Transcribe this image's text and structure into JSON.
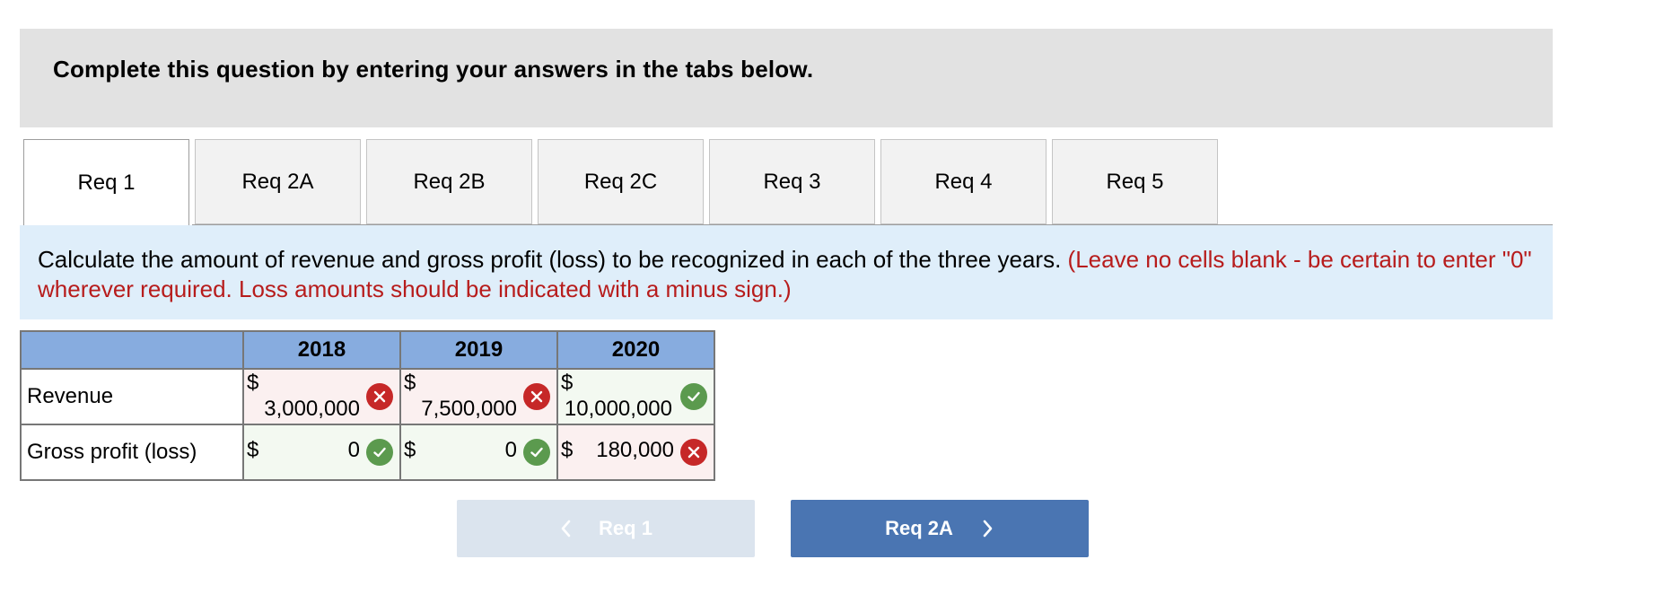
{
  "banner": {
    "title": "Complete this question by entering your answers in the tabs below."
  },
  "tabs": [
    {
      "label": "Req 1",
      "active": true
    },
    {
      "label": "Req 2A",
      "active": false
    },
    {
      "label": "Req 2B",
      "active": false
    },
    {
      "label": "Req 2C",
      "active": false
    },
    {
      "label": "Req 3",
      "active": false
    },
    {
      "label": "Req 4",
      "active": false
    },
    {
      "label": "Req 5",
      "active": false
    }
  ],
  "instructions": {
    "text": "Calculate the amount of revenue and gross profit (loss) to be recognized in each of the three years. ",
    "note": "(Leave no cells blank - be certain to enter \"0\" wherever required. Loss amounts should be indicated with a minus sign.)"
  },
  "table": {
    "corner": "",
    "columns": [
      "2018",
      "2019",
      "2020"
    ],
    "rows": [
      {
        "label": "Revenue",
        "cells": [
          {
            "symbol": "$",
            "value": "3,000,000",
            "status": "incorrect"
          },
          {
            "symbol": "$",
            "value": "7,500,000",
            "status": "incorrect"
          },
          {
            "symbol": "$",
            "value": "10,000,000",
            "status": "correct"
          }
        ]
      },
      {
        "label": "Gross profit (loss)",
        "cells": [
          {
            "symbol": "$",
            "value": "0",
            "status": "correct"
          },
          {
            "symbol": "$",
            "value": "0",
            "status": "correct"
          },
          {
            "symbol": "$",
            "value": "180,000",
            "status": "incorrect"
          }
        ]
      }
    ]
  },
  "nav": {
    "prev_label": "Req 1",
    "next_label": "Req 2A"
  },
  "colors": {
    "incorrect": "#c62828",
    "correct": "#5b9a4e",
    "header_blue": "#87acdf",
    "next_button": "#4a75b2",
    "note_red": "#b71c1c"
  }
}
